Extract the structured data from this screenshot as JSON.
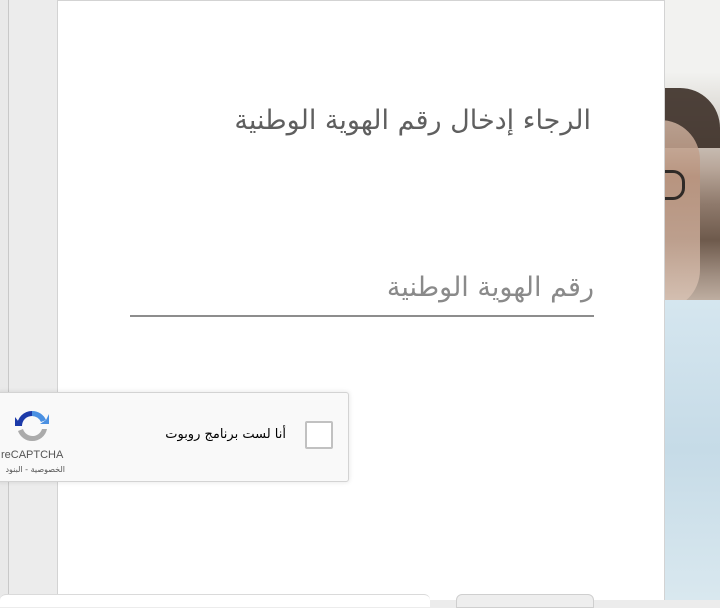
{
  "form": {
    "heading": "الرجاء إدخال رقم الهوية الوطنية",
    "id_input_placeholder": "رقم الهوية الوطنية",
    "id_input_value": ""
  },
  "recaptcha": {
    "checkbox_label": "أنا لست برنامج روبوت",
    "brand": "reCAPTCHA",
    "terms": "الخصوصية - البنود",
    "checked": false,
    "logo_icon": "recaptcha-logo-icon",
    "logo_colors": [
      "#4a90e2",
      "#1c3aa9",
      "#ababab"
    ]
  },
  "colors": {
    "heading_text": "#5f5f5f",
    "input_underline": "#8d8d8d",
    "card_background": "#ffffff"
  }
}
